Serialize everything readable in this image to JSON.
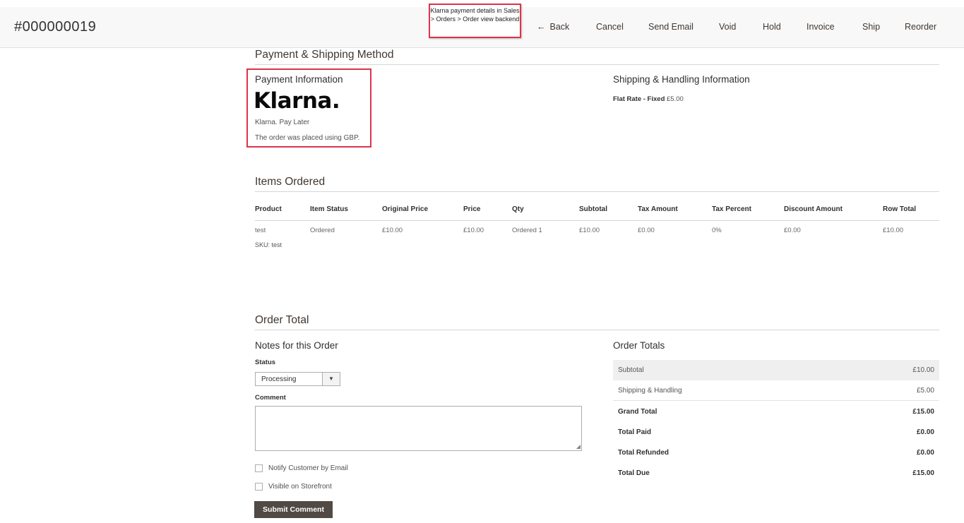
{
  "header": {
    "order_id": "#000000019",
    "callout_text": "Klarna payment details in Sales > Orders > Order view backend",
    "actions": {
      "back": "Back",
      "cancel": "Cancel",
      "send_email": "Send Email",
      "void": "Void",
      "hold": "Hold",
      "invoice": "Invoice",
      "ship": "Ship",
      "reorder": "Reorder"
    },
    "back_arrow": "←"
  },
  "payment_shipping": {
    "section_title": "Payment & Shipping Method",
    "payment": {
      "title": "Payment Information",
      "logo_text": "Klarna.",
      "method": "Klarna. Pay Later",
      "currency_note": "The order was placed using GBP."
    },
    "shipping": {
      "title": "Shipping & Handling Information",
      "method_label": "Flat Rate - Fixed",
      "method_price": "£5.00"
    }
  },
  "items": {
    "section_title": "Items Ordered",
    "columns": [
      "Product",
      "Item Status",
      "Original Price",
      "Price",
      "Qty",
      "Subtotal",
      "Tax Amount",
      "Tax Percent",
      "Discount Amount",
      "Row Total"
    ],
    "rows": [
      {
        "cells": [
          "test",
          "Ordered",
          "£10.00",
          "£10.00",
          "Ordered 1",
          "£10.00",
          "£0.00",
          "0%",
          "£0.00",
          "£10.00"
        ],
        "sku": "SKU: test"
      }
    ]
  },
  "order_total": {
    "section_title": "Order Total",
    "notes": {
      "title": "Notes for this Order",
      "status_label": "Status",
      "status_value": "Processing",
      "dropdown_glyph": "▼",
      "comment_label": "Comment",
      "comment_value": "",
      "resize_glyph": "◢",
      "notify_label": "Notify Customer by Email",
      "visible_label": "Visible on Storefront",
      "submit_label": "Submit Comment"
    },
    "totals": {
      "title": "Order Totals",
      "rows": [
        {
          "label": "Subtotal",
          "value": "£10.00"
        },
        {
          "label": "Shipping & Handling",
          "value": "£5.00"
        },
        {
          "label": "Grand Total",
          "value": "£15.00"
        },
        {
          "label": "Total Paid",
          "value": "£0.00"
        },
        {
          "label": "Total Refunded",
          "value": "£0.00"
        },
        {
          "label": "Total Due",
          "value": "£15.00"
        }
      ]
    }
  },
  "colors": {
    "highlight": "#e0324a",
    "button_dark": "#514943",
    "header_bg": "#f8f8f8"
  }
}
